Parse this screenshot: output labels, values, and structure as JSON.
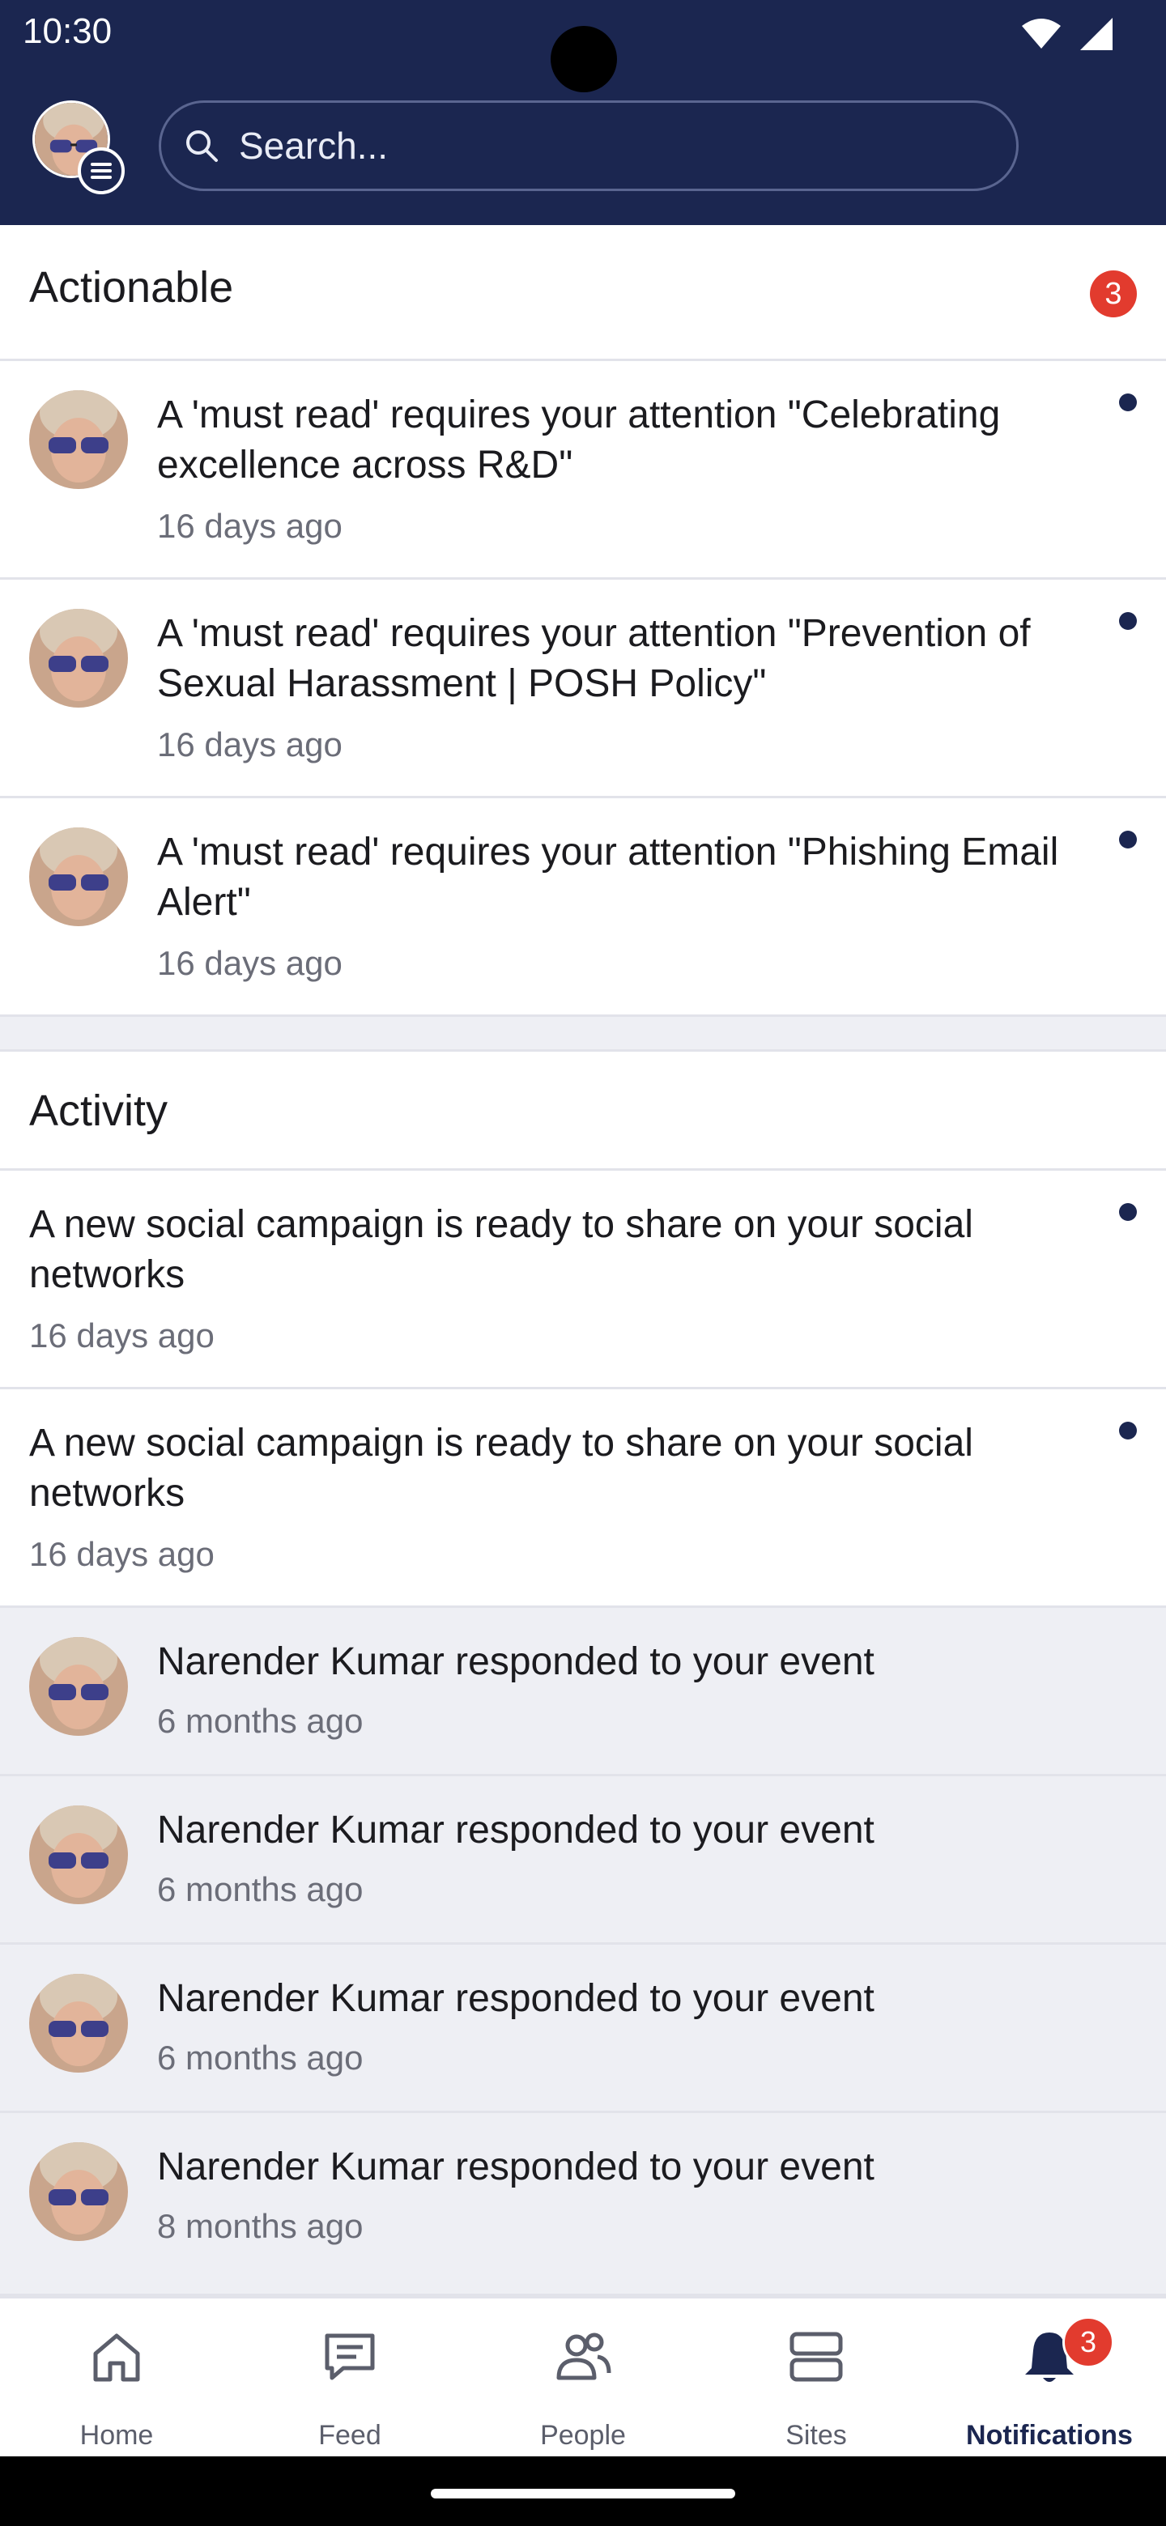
{
  "status_bar": {
    "time": "10:30"
  },
  "search": {
    "placeholder": "Search..."
  },
  "actionable": {
    "title": "Actionable",
    "count": "3",
    "items": [
      {
        "text": "A 'must read' requires your attention \"Celebrating excellence across R&D\"",
        "time": "16 days ago"
      },
      {
        "text": "A 'must read' requires your attention \"Prevention of Sexual Harassment | POSH Policy\"",
        "time": "16 days ago"
      },
      {
        "text": "A 'must read' requires your attention \"Phishing Email Alert\"",
        "time": "16 days ago"
      }
    ]
  },
  "activity": {
    "title": "Activity",
    "items": [
      {
        "text": "A new social campaign is ready to share on your social networks",
        "time": "16 days ago"
      },
      {
        "text": "A new social campaign is ready to share on your social networks",
        "time": "16 days ago"
      },
      {
        "text": "Narender Kumar responded to your event",
        "time": "6 months ago"
      },
      {
        "text": "Narender Kumar responded to your event",
        "time": "6 months ago"
      },
      {
        "text": "Narender Kumar responded to your event",
        "time": "6 months ago"
      },
      {
        "text": "Narender Kumar responded to your event",
        "time": "8 months ago"
      }
    ]
  },
  "nav": {
    "items": [
      {
        "label": "Home",
        "icon": "home-icon"
      },
      {
        "label": "Feed",
        "icon": "feed-icon"
      },
      {
        "label": "People",
        "icon": "people-icon"
      },
      {
        "label": "Sites",
        "icon": "sites-icon"
      },
      {
        "label": "Notifications",
        "icon": "bell-icon",
        "badge": "3",
        "active": true
      }
    ]
  },
  "colors": {
    "header_bg": "#1b2650",
    "badge_red": "#e23b2e",
    "unread_dot": "#1b2650",
    "read_row_bg": "#eeeff4"
  }
}
